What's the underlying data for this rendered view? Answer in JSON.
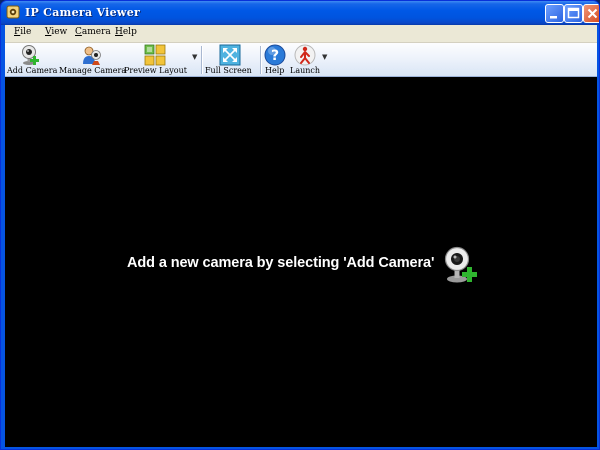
{
  "window": {
    "title": "IP Camera Viewer"
  },
  "menu": [
    {
      "accel": "F",
      "rest": "ile"
    },
    {
      "accel": "V",
      "rest": "iew"
    },
    {
      "accel": "C",
      "rest": "amera"
    },
    {
      "accel": "H",
      "rest": "elp"
    }
  ],
  "toolbar": {
    "add_camera": "Add Camera",
    "manage_camera": "Manage Camera",
    "preview_layout": "Preview Layout",
    "full_screen": "Full Screen",
    "help": "Help",
    "launch": "Launch"
  },
  "content": {
    "hint": "Add a new camera by selecting 'Add Camera'"
  },
  "icons": {
    "app": "camera-app-icon",
    "add_camera": "webcam-add-icon",
    "manage_camera": "manage-camera-icon",
    "preview_layout": "grid-layout-icon",
    "full_screen": "fullscreen-icon",
    "help": "help-icon",
    "launch": "launch-icon"
  },
  "colors": {
    "title_bar": "#0058e6",
    "toolbar": "#eef3fb",
    "content_bg": "#000000",
    "accent_green": "#2fb52f"
  }
}
